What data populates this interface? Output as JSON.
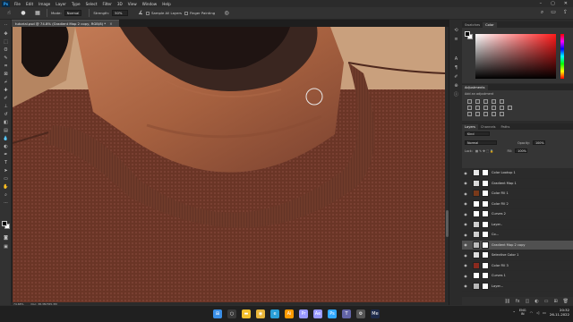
{
  "app": {
    "logo": "Ps"
  },
  "menu": [
    "File",
    "Edit",
    "Image",
    "Layer",
    "Type",
    "Select",
    "Filter",
    "3D",
    "View",
    "Window",
    "Help"
  ],
  "options": {
    "mode_label": "Mode:",
    "mode_value": "Normal",
    "strength_label": "Strength:",
    "strength_value": "50%",
    "sample_all_layers": "Sample All Layers",
    "finger_painting": "Finger Painting"
  },
  "document_tab": {
    "title": "tutorial.psd @ 74.8% (Gradient Map 2 copy, RGB/8) *",
    "close": "×"
  },
  "status": {
    "zoom": "74.68%",
    "doc": "Doc: 38.3M/765.3M"
  },
  "panels": {
    "top_tabs": [
      "Swatches",
      "Color"
    ],
    "adjustments": {
      "title": "Adjustments",
      "subtitle": "Add an adjustment"
    },
    "layers_tabs": [
      "Layers",
      "Channels",
      "Paths"
    ],
    "blend_mode": "Normal",
    "opacity_label": "Opacity:",
    "opacity_value": "100%",
    "lock_label": "Lock:",
    "fill_label": "Fill:",
    "fill_value": "100%",
    "kind_label": "Kind"
  },
  "layers": [
    {
      "name": "Color Lookup 1",
      "thumb": "#e8e8e8"
    },
    {
      "name": "Gradient Map 1",
      "thumb": "#d9d9d9"
    },
    {
      "name": "Color Fill 1",
      "thumb": "#7a3a1a"
    },
    {
      "name": "Color Fill 2",
      "thumb": "#ffffff"
    },
    {
      "name": "Curves 2",
      "thumb": "#ffffff"
    },
    {
      "name": "Layer..",
      "thumb": "#cfcfcf"
    },
    {
      "name": "Co...",
      "thumb": "#cfcfcf"
    },
    {
      "name": "Gradient Map 2 copy",
      "thumb": "#bbbbbb"
    },
    {
      "name": "Selective Color 1",
      "thumb": "#dddddd"
    },
    {
      "name": "Color Fill 3",
      "thumb": "#8a2a1e"
    },
    {
      "name": "Curves 1",
      "thumb": "#ffffff"
    },
    {
      "name": "Layer...",
      "thumb": "#b8b8b8"
    }
  ],
  "selected_layer_index": 7,
  "taskbar": {
    "lang_line1": "ENG",
    "lang_line2": "IN",
    "time": "20:32",
    "date": "26-11-2022",
    "apps": [
      {
        "icon": "windows-icon",
        "color": "#3a8fe8",
        "glyph": "⊞"
      },
      {
        "icon": "search-icon",
        "color": "#3a3a3a",
        "glyph": "○"
      },
      {
        "icon": "file-explorer-icon",
        "color": "#f3c02c",
        "glyph": "▬"
      },
      {
        "icon": "chrome-icon",
        "color": "#e8b53a",
        "glyph": "◉"
      },
      {
        "icon": "edge-icon",
        "color": "#2a9fd8",
        "glyph": "e"
      },
      {
        "icon": "illustrator-icon",
        "color": "#ff9a00",
        "glyph": "Ai"
      },
      {
        "icon": "premiere-icon",
        "color": "#9999ff",
        "glyph": "Pr"
      },
      {
        "icon": "after-effects-icon",
        "color": "#9999ff",
        "glyph": "Ae"
      },
      {
        "icon": "photoshop-icon",
        "color": "#31a8ff",
        "glyph": "Ps"
      },
      {
        "icon": "teams-icon",
        "color": "#6264a7",
        "glyph": "T"
      },
      {
        "icon": "settings-icon",
        "color": "#555555",
        "glyph": "⚙"
      },
      {
        "icon": "media-encoder-icon",
        "color": "#1e2a4a",
        "glyph": "Me"
      }
    ]
  }
}
